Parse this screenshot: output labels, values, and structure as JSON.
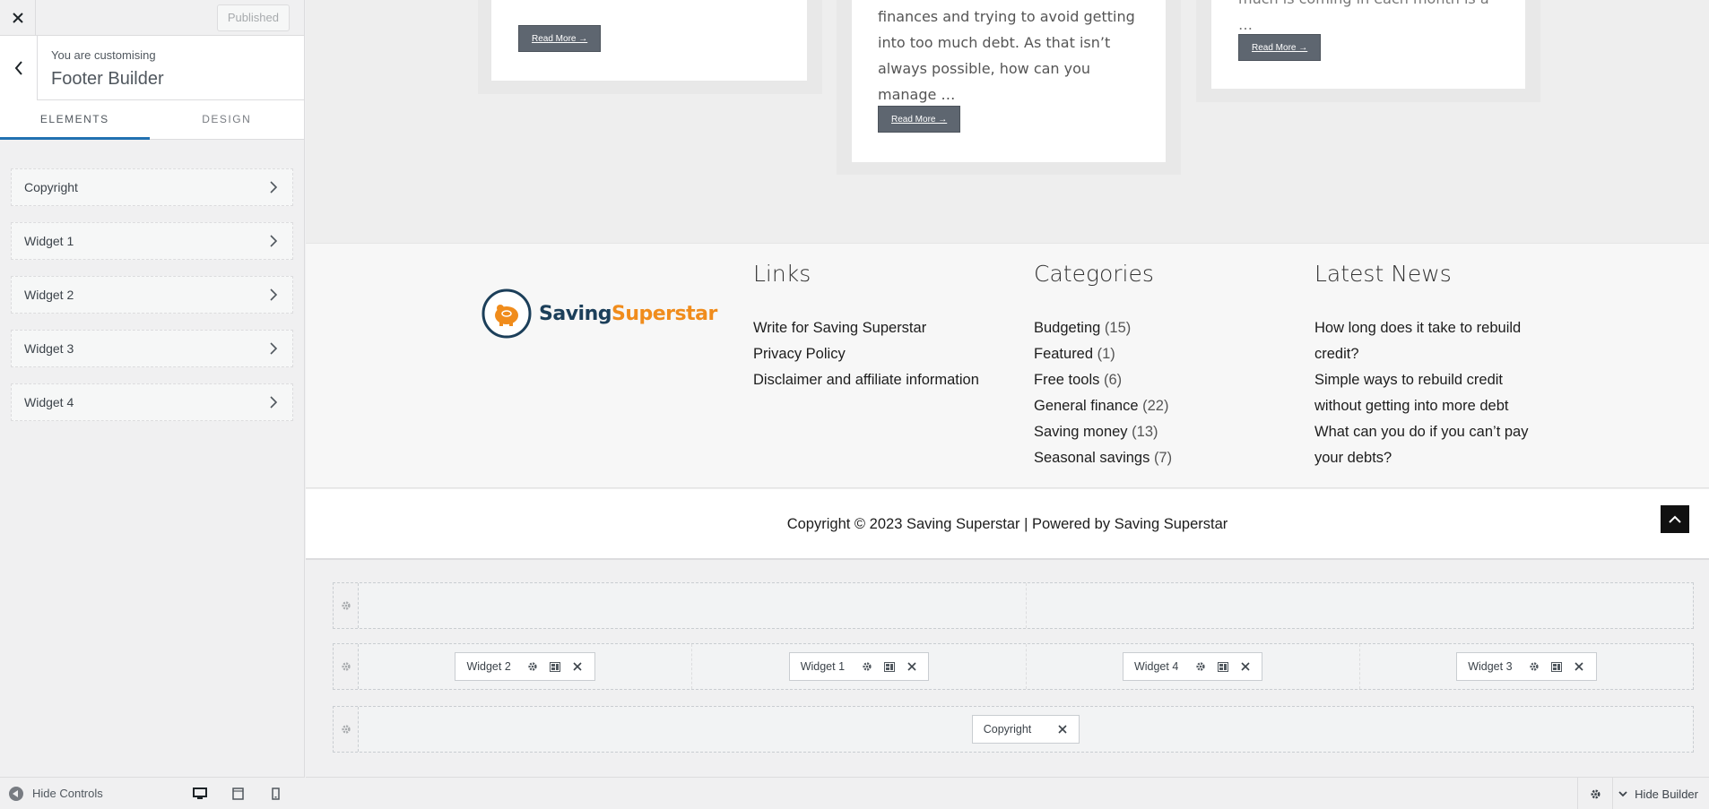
{
  "sidebar": {
    "published_label": "Published",
    "customising_label": "You are customising",
    "panel_title": "Footer Builder",
    "tabs": [
      {
        "label": "ELEMENTS",
        "active": true
      },
      {
        "label": "DESIGN",
        "active": false
      }
    ],
    "items": [
      {
        "label": "Copyright"
      },
      {
        "label": "Widget 1"
      },
      {
        "label": "Widget 2"
      },
      {
        "label": "Widget 3"
      },
      {
        "label": "Widget 4"
      }
    ],
    "hide_controls_label": "Hide Controls",
    "devices": [
      "desktop-icon",
      "tablet-icon",
      "mobile-icon"
    ]
  },
  "preview": {
    "cards": [
      {
        "text": "",
        "read_more": "Read More →"
      },
      {
        "text": "finances and trying to avoid getting into too much debt. As that isn’t always possible, how can you manage …",
        "read_more": "Read More →"
      },
      {
        "text": "much is coming in each month is a …",
        "read_more": "Read More →"
      }
    ],
    "logo": {
      "part1": "Saving",
      "part2": "Superstar"
    },
    "links": {
      "title": "Links",
      "items": [
        "Write for Saving Superstar",
        "Privacy Policy",
        "Disclaimer and affiliate information"
      ]
    },
    "categories": {
      "title": "Categories",
      "items": [
        {
          "name": "Budgeting",
          "count": "(15)"
        },
        {
          "name": "Featured",
          "count": "(1)"
        },
        {
          "name": "Free tools",
          "count": "(6)"
        },
        {
          "name": "General finance",
          "count": "(22)"
        },
        {
          "name": "Saving money",
          "count": "(13)"
        },
        {
          "name": "Seasonal savings",
          "count": "(7)"
        }
      ]
    },
    "latest_news": {
      "title": "Latest News",
      "items": [
        "How long does it take to rebuild credit?",
        "Simple ways to rebuild credit without getting into more debt",
        "What can you do if you can’t pay your debts?"
      ]
    },
    "copyright": "Copyright © 2023 Saving Superstar | Powered by Saving Superstar"
  },
  "builder": {
    "rows": [
      {
        "columns": [
          [],
          []
        ]
      },
      {
        "columns": [
          [
            "Widget 2"
          ],
          [
            "Widget 1"
          ],
          [
            "Widget 4"
          ],
          [
            "Widget 3"
          ]
        ]
      },
      {
        "columns": [
          [
            "Copyright"
          ]
        ]
      }
    ],
    "hide_builder_label": "Hide Builder"
  },
  "colors": {
    "accent": "#2271b1",
    "button": "#5e6670",
    "logo_blue": "#1c3f5a",
    "logo_orange": "#f08c1c"
  }
}
